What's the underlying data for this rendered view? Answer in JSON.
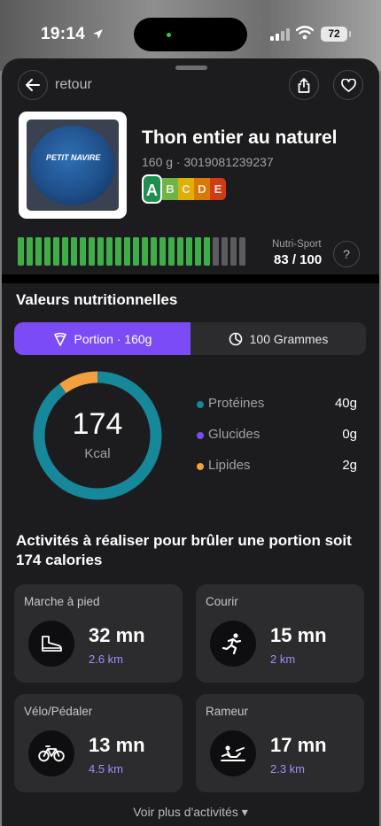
{
  "status_bar": {
    "time": "19:14",
    "battery": "72"
  },
  "header": {
    "back_label": "retour"
  },
  "product": {
    "name": "Thon entier au naturel",
    "meta": "160 g · 3019081239237",
    "brand_text": "PETIT NAVIRE",
    "nutriscore": {
      "letters": [
        "A",
        "B",
        "C",
        "D",
        "E"
      ],
      "active": "A",
      "colors": [
        "#1e8f4e",
        "#7ac547",
        "#f5c100",
        "#ef8200",
        "#e63e11"
      ]
    }
  },
  "nutri_sport": {
    "label": "Nutri-Sport",
    "value": "83 / 100",
    "score": 83,
    "max": 100,
    "help": "?"
  },
  "nutrition": {
    "title": "Valeurs nutritionnelles",
    "tabs": [
      "Portion · 160g",
      "100 Grammes"
    ],
    "active_tab": 0,
    "kcal": "174",
    "kcal_unit": "Kcal",
    "macros": [
      {
        "label": "Protéines",
        "value": "40g",
        "color": "#17879a"
      },
      {
        "label": "Glucides",
        "value": "0g",
        "color": "#7b4cf5"
      },
      {
        "label": "Lipides",
        "value": "2g",
        "color": "#f2a03d"
      }
    ]
  },
  "activities": {
    "title": "Activités à réaliser pour brûler une portion soit 174 calories",
    "items": [
      {
        "label": "Marche à pied",
        "time": "32 mn",
        "distance": "2.6 km",
        "icon": "shoe-icon"
      },
      {
        "label": "Courir",
        "time": "15 mn",
        "distance": "2 km",
        "icon": "runner-icon"
      },
      {
        "label": "Vélo/Pédaler",
        "time": "13 mn",
        "distance": "4.5 km",
        "icon": "bike-icon"
      },
      {
        "label": "Rameur",
        "time": "17 mn",
        "distance": "2.3 km",
        "icon": "rower-icon"
      }
    ],
    "more_label": "Voir plus d'activités ▾"
  }
}
